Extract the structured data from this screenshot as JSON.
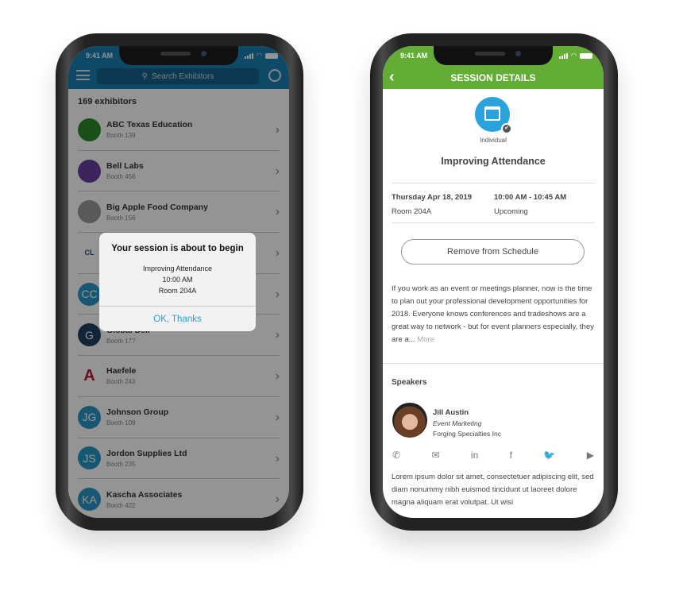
{
  "status": {
    "time": "9:41 AM"
  },
  "exhibitors": {
    "search_placeholder": "Search Exhibitors",
    "count": "169 exhibitors",
    "items": [
      {
        "name": "ABC Texas Education",
        "booth": "Booth 139",
        "logo": "",
        "color": "#2a8a2a"
      },
      {
        "name": "Bell Labs",
        "booth": "Booth 456",
        "logo": "",
        "color": "#6a3fa0"
      },
      {
        "name": "Big Apple Food Company",
        "booth": "Booth 156",
        "logo": "",
        "color": "#9a9a9a"
      },
      {
        "name": "",
        "booth": "",
        "logo": "CL",
        "color": "#ffffff"
      },
      {
        "name": "",
        "booth": "",
        "logo": "CC",
        "color": "#2a97c9"
      },
      {
        "name": "Global Deli",
        "booth": "Booth 177",
        "logo": "G",
        "color": "#1f3f5f"
      },
      {
        "name": "Haefele",
        "booth": "Booth 243",
        "logo": "A",
        "color": "#ffffff"
      },
      {
        "name": "Johnson Group",
        "booth": "Booth 109",
        "logo": "JG",
        "color": "#2a97c9"
      },
      {
        "name": "Jordon Supplies Ltd",
        "booth": "Booth 235",
        "logo": "JS",
        "color": "#2a97c9"
      },
      {
        "name": "Kascha Associates",
        "booth": "Booth 422",
        "logo": "KA",
        "color": "#2a97c9"
      }
    ]
  },
  "alert": {
    "title": "Your session is about to begin",
    "session": "Improving Attendance",
    "time": "10:00 AM",
    "room": "Room 204A",
    "button": "OK, Thanks"
  },
  "session": {
    "header": "SESSION DETAILS",
    "type": "Individual",
    "title": "Improving Attendance",
    "date": "Thursday Apr 18, 2019",
    "room": "Room 204A",
    "time": "10:00 AM - 10:45 AM",
    "state": "Upcoming",
    "remove_button": "Remove from Schedule",
    "description": "If you work as an event or meetings planner, now is the time to plan out your professional development opportunities for 2018. Everyone knows conferences and tradeshows are a great way to network - but for event planners especially, they are a...",
    "more": "More",
    "speakers_heading": "Speakers",
    "speaker": {
      "name": "Jill Austin",
      "role": "Event Marketing",
      "company": "Forging Specialties Inc"
    },
    "bio": "Lorem ipsum dolor sit amet, consectetuer adipiscing elit, sed diam nonummy nibh euismod tincidunt ut laoreet dolore magna aliquam erat volutpat. Ut wisi"
  },
  "colors": {
    "left_header": "#1b7fb3",
    "right_header": "#63ad37",
    "accent": "#2aa3dc"
  }
}
